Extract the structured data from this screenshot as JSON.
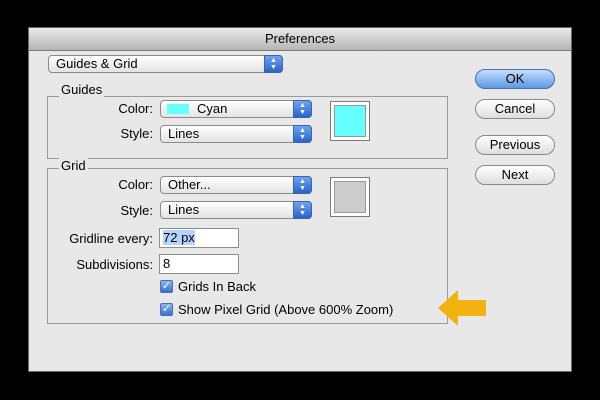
{
  "window": {
    "title": "Preferences"
  },
  "section_popup": {
    "value": "Guides & Grid"
  },
  "guides": {
    "title": "Guides",
    "color_label": "Color:",
    "color_value": "Cyan",
    "color_hex": "#66ffff",
    "style_label": "Style:",
    "style_value": "Lines"
  },
  "grid": {
    "title": "Grid",
    "color_label": "Color:",
    "color_value": "Other...",
    "color_hex": "#cccccc",
    "style_label": "Style:",
    "style_value": "Lines",
    "gridline_label": "Gridline every:",
    "gridline_value": "72 px",
    "subdivisions_label": "Subdivisions:",
    "subdivisions_value": "8",
    "grids_in_back_label": "Grids In Back",
    "grids_in_back_checked": true,
    "show_pixel_grid_label": "Show Pixel Grid (Above 600% Zoom)",
    "show_pixel_grid_checked": true
  },
  "buttons": {
    "ok": "OK",
    "cancel": "Cancel",
    "previous": "Previous",
    "next": "Next"
  },
  "annotation": {
    "arrow_color": "#f2b310"
  }
}
